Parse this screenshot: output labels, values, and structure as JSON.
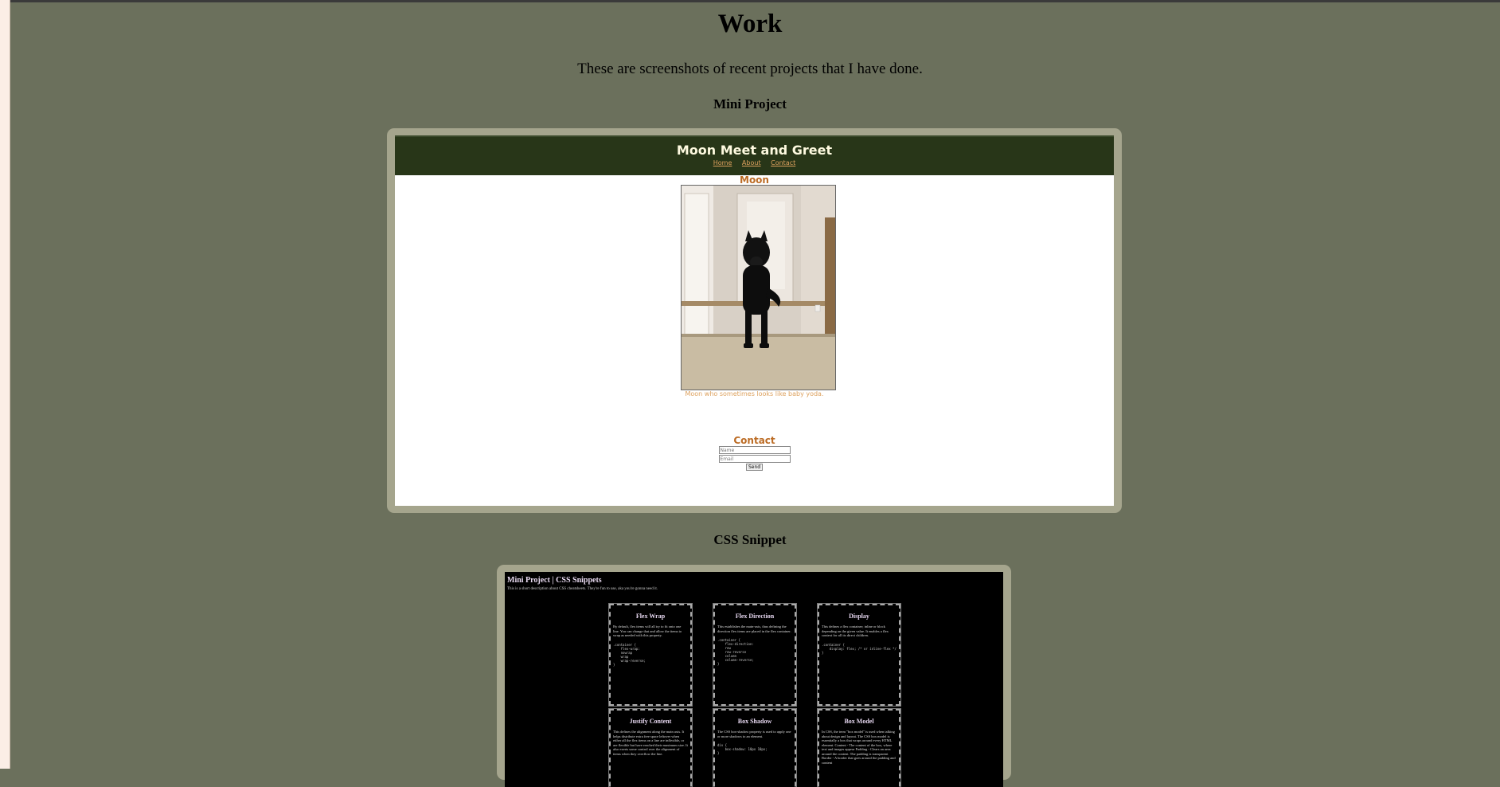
{
  "page": {
    "title": "Work",
    "intro": "These are screenshots of recent projects that I have done."
  },
  "sections": [
    {
      "heading": "Mini Project"
    },
    {
      "heading": "CSS Snippet"
    }
  ],
  "mini_project": {
    "site_title": "Moon Meet and Greet",
    "nav": [
      "Home",
      "About",
      "Contact"
    ],
    "moon_heading": "Moon",
    "photo_caption": "Moon who sometimes looks like baby yoda.",
    "contact_heading": "Contact",
    "name_placeholder": "Name",
    "email_placeholder": "Email",
    "send_label": "Send",
    "colors": {
      "header_bg": "#283618",
      "accent": "#bc6c25",
      "link": "#dda15e"
    }
  },
  "css_snippet": {
    "title": "Mini Project | CSS Snippets",
    "description": "This is a short description about CSS cheatsheets. They're fun to use, aka you're gonna need it.",
    "cards": [
      {
        "title": "Flex Wrap",
        "text": "By default, flex items will all try to fit onto one line. You can change that and allow the items to wrap as needed with this property.",
        "code": ".container {\n    flex-wrap:\n    nowrap\n    wrap\n    wrap-reverse;\n}"
      },
      {
        "title": "Flex Direction",
        "text": "This establishes the main-axis, thus defining the direction flex items are placed in the flex container.",
        "code": ".container {\n    flex-direction:\n    row\n    row-reverse\n    column\n    column-reverse;\n}"
      },
      {
        "title": "Display",
        "text": "This defines a flex container; inline or block depending on the given value. It enables a flex context for all its direct children.",
        "code": ".container {\n    display: flex; /* or inline-flex */\n}"
      },
      {
        "title": "Justify Content",
        "text": "This defines the alignment along the main axis. It helps distribute extra free space leftover when either all the flex items on a line are inflexible, or are flexible but have reached their maximum size. It also exerts some control over the alignment of items when they overflow the line.",
        "code": ""
      },
      {
        "title": "Box Shadow",
        "text": "The CSS box-shadow property is used to apply one or more shadows to an element.",
        "code": "div {\n    box-shadow: 10px 10px;\n}"
      },
      {
        "title": "Box Model",
        "text": "In CSS, the term \"box model\" is used when talking about design and layout. The CSS box model is essentially a box that wraps around every HTML element. Content - The content of the box, where text and images appear Padding - Clears an area around the content. The padding is transparent Border - A border that goes around the padding and content",
        "code": ""
      }
    ]
  },
  "colors": {
    "page_bg": "#6b705c",
    "frame": "#a5a58d"
  }
}
